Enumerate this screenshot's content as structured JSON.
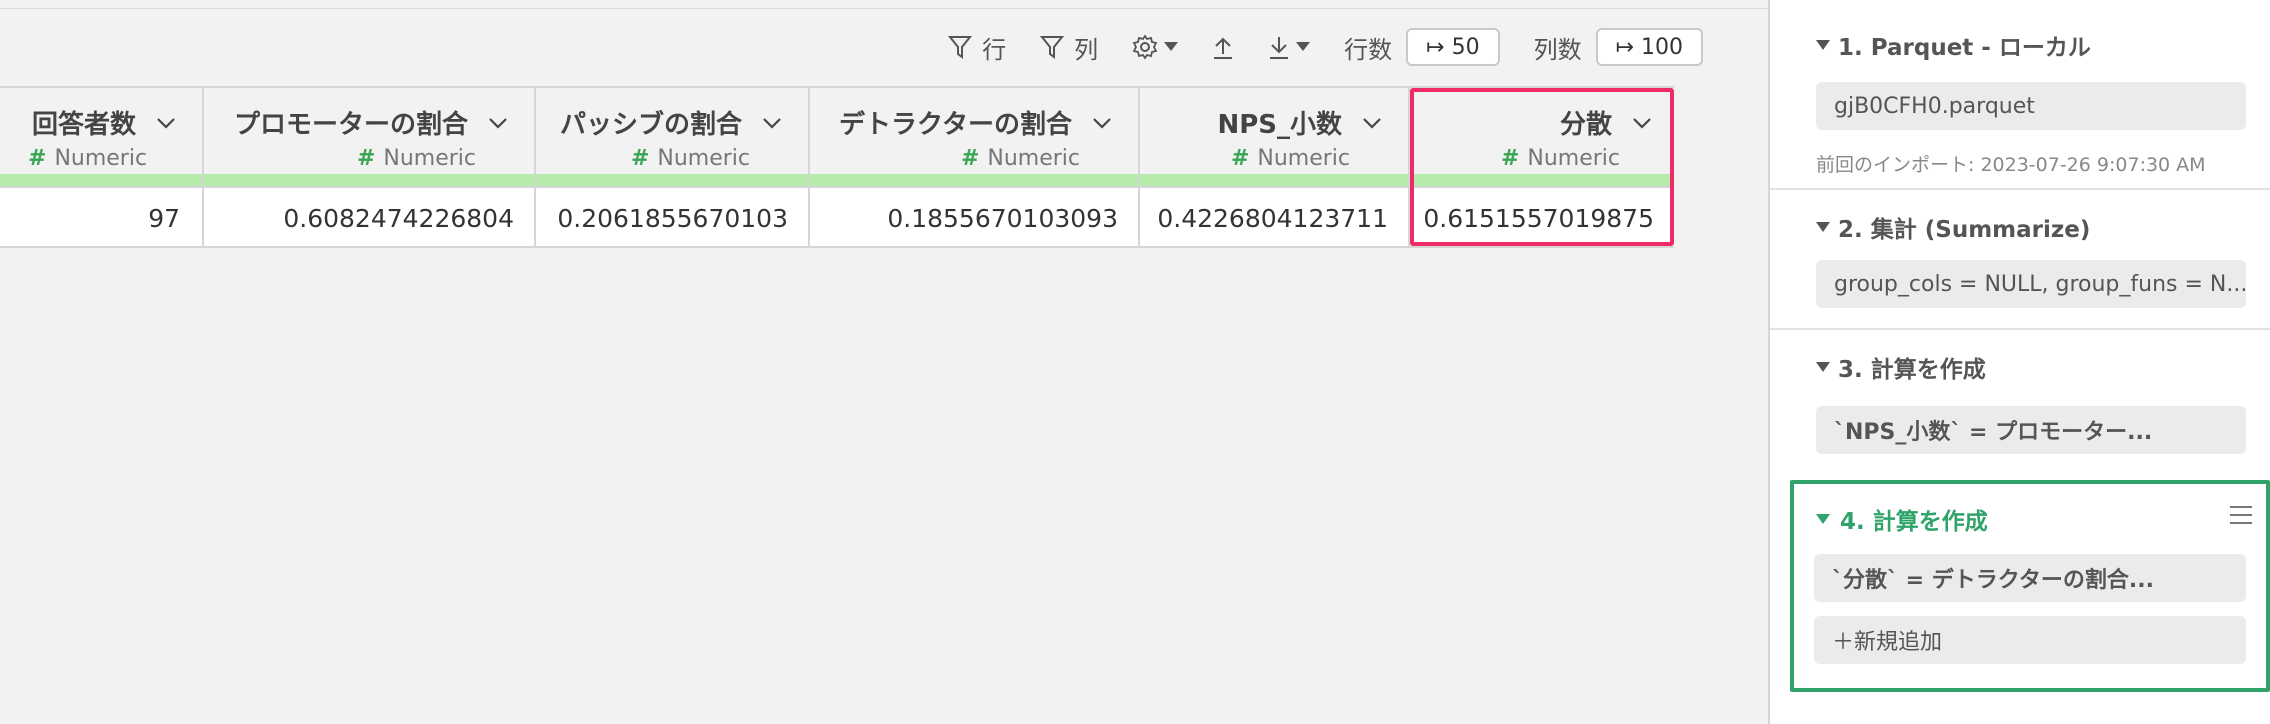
{
  "toolbar": {
    "row_filter_label": "行",
    "col_filter_label": "列",
    "rows_label": "行数",
    "rows_value": "↦ 50",
    "cols_label": "列数",
    "cols_value": "↦ 100"
  },
  "table": {
    "columns": [
      {
        "name": "回答者数",
        "type": "Numeric",
        "value": "97"
      },
      {
        "name": "プロモーターの割合",
        "type": "Numeric",
        "value": "0.6082474226804"
      },
      {
        "name": "パッシブの割合",
        "type": "Numeric",
        "value": "0.2061855670103"
      },
      {
        "name": "デトラクターの割合",
        "type": "Numeric",
        "value": "0.1855670103093"
      },
      {
        "name": "NPS_小数",
        "type": "Numeric",
        "value": "0.4226804123711"
      },
      {
        "name": "分散",
        "type": "Numeric",
        "value": "0.6151557019875"
      }
    ],
    "type_icon": "#",
    "highlight_color": "#ee2a67",
    "type_bar_color": "#b5ecaa"
  },
  "steps": [
    {
      "title": "1. Parquet - ローカル",
      "detail": "gjB0CFH0.parquet",
      "meta": "前回のインポート: 2023-07-26 9:07:30 AM"
    },
    {
      "title": "2. 集計 (Summarize)",
      "detail": "group_cols = NULL, group_funs = N..."
    },
    {
      "title": "3. 計算を作成",
      "detail": "`NPS_小数` = プロモーター..."
    },
    {
      "title": "4. 計算を作成",
      "detail": "`分散` = デトラクターの割合...",
      "add_label": "＋新規追加",
      "accent": "#2fa36a"
    }
  ]
}
